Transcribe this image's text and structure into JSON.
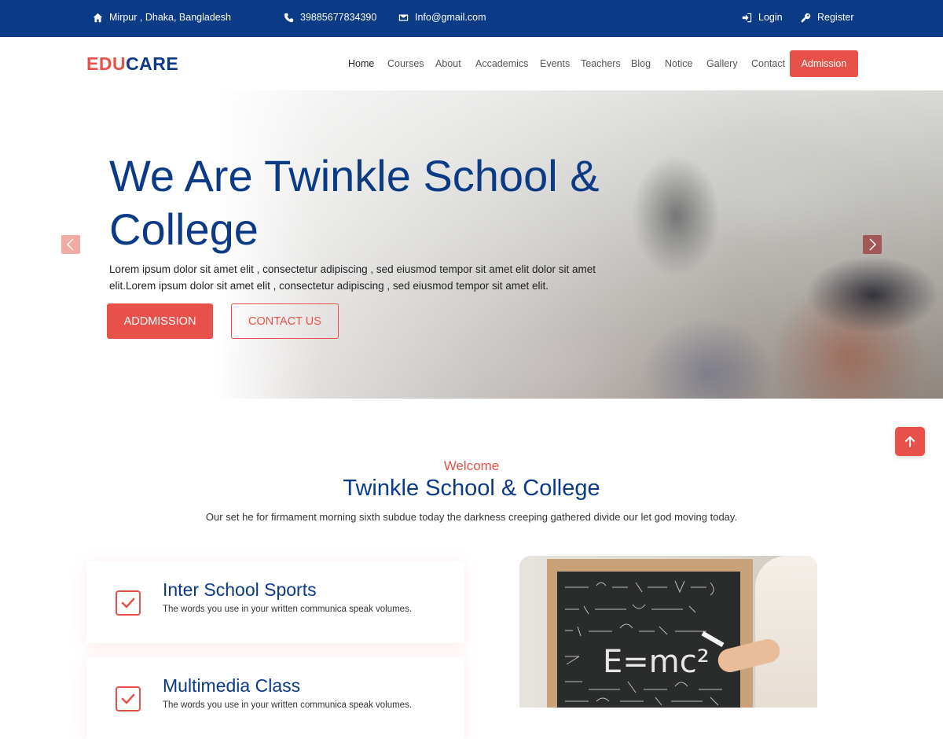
{
  "topbar": {
    "address": "Mirpur , Dhaka, Bangladesh",
    "phone": "39885677834390",
    "email": "Info@gmail.com",
    "login": "Login",
    "register": "Register"
  },
  "header": {
    "logo_part1": "EDU",
    "logo_part2": "CARE",
    "nav": [
      "Home",
      "Courses",
      "About",
      "Accademics",
      "Events",
      "Teachers",
      "Blog",
      "Notice",
      "Gallery",
      "Contact"
    ],
    "active_nav": "Home",
    "admission_button": "Admission"
  },
  "hero": {
    "title": "We Are Twinkle School & College",
    "text": "Lorem ipsum dolor sit amet elit , consectetur adipiscing , sed eiusmod tempor sit amet elit dolor sit amet elit.Lorem ipsum dolor sit amet elit , consectetur adipiscing , sed eiusmod tempor sit amet elit.",
    "primary_button": "ADDMISSION",
    "secondary_button": "CONTACT US"
  },
  "welcome": {
    "label": "Welcome",
    "title": "Twinkle School & College",
    "text": "Our set he for firmament morning sixth subdue today the darkness creeping gathered divide our let god moving today."
  },
  "features": [
    {
      "title": "Inter School Sports",
      "text": "The words you use in your written communica speak volumes."
    },
    {
      "title": "Multimedia Class",
      "text": "The words you use in your written communica speak volumes."
    }
  ],
  "chalkboard": {
    "formula": "E=mc²"
  },
  "colors": {
    "brand_blue": "#0b3a86",
    "accent_red": "#e8504a"
  },
  "icons": {
    "address": "home-icon",
    "phone": "phone-icon",
    "email": "envelope-icon",
    "login": "sign-in-icon",
    "register": "key-icon",
    "slider_prev": "chevron-left-icon",
    "slider_next": "chevron-right-icon",
    "back_to_top": "arrow-up-icon",
    "feature_check": "checkbox-icon"
  }
}
